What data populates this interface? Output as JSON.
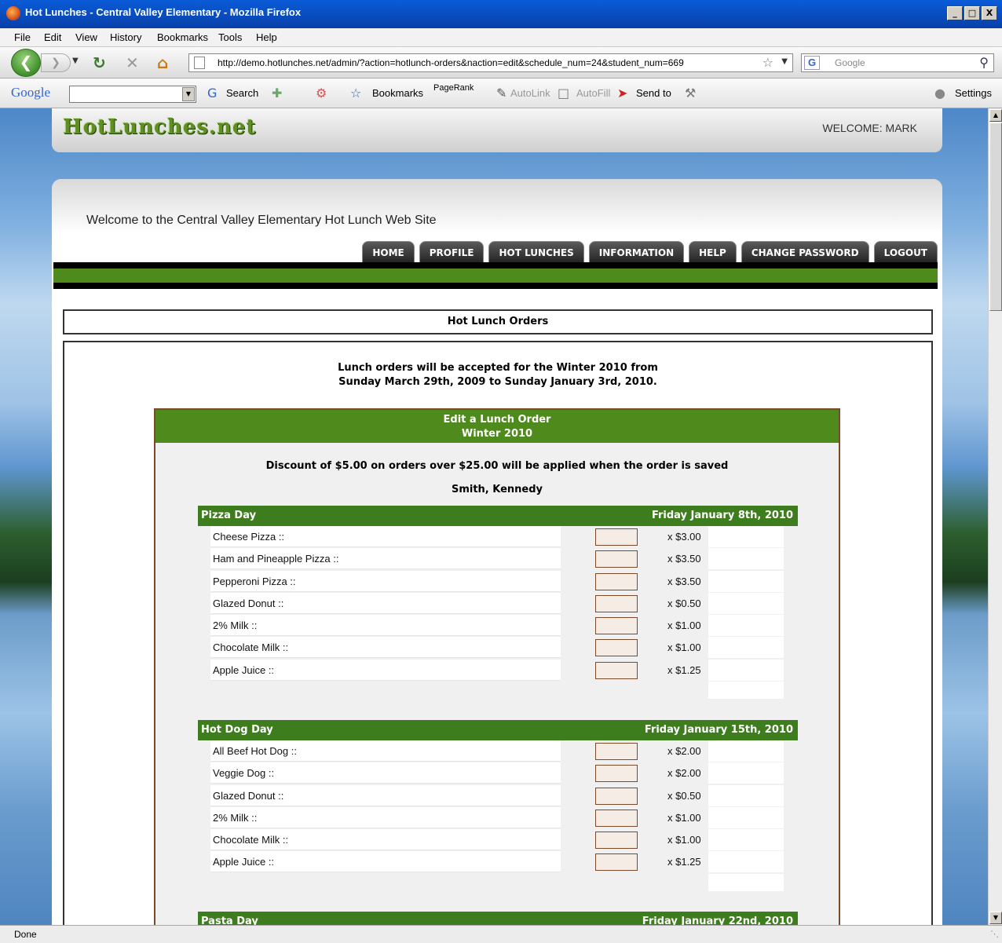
{
  "window": {
    "title": "Hot Lunches - Central Valley Elementary - Mozilla Firefox",
    "buttons": [
      "_",
      "□",
      "X"
    ]
  },
  "menu": [
    "File",
    "Edit",
    "View",
    "History",
    "Bookmarks",
    "Tools",
    "Help"
  ],
  "nav": {
    "url": "http://demo.hotlunches.net/admin/?action=hotlunch-orders&naction=edit&schedule_num=24&student_num=669",
    "search_placeholder": "Google"
  },
  "google_toolbar": {
    "logo": "Google",
    "search": "Search",
    "bookmarks": "Bookmarks",
    "pagerank": "PageRank",
    "autolink": "AutoLink",
    "autofill": "AutoFill",
    "sendto": "Send to",
    "settings": "Settings"
  },
  "status": "Done",
  "site": {
    "logo": "HotLunches.net",
    "welcome_user": "WELCOME: MARK",
    "welcome_text": "Welcome to the Central Valley Elementary Hot Lunch Web Site",
    "tabs": [
      "HOME",
      "PROFILE",
      "HOT LUNCHES",
      "INFORMATION",
      "HELP",
      "CHANGE PASSWORD",
      "LOGOUT"
    ],
    "page_title": "Hot Lunch Orders",
    "notice_line1": "Lunch orders will be accepted for the Winter 2010 from",
    "notice_line2": "Sunday March 29th, 2009 to Sunday January 3rd, 2010.",
    "panel_title": "Edit a Lunch Order",
    "panel_subtitle": "Winter 2010",
    "discount": "Discount of $5.00 on orders over $25.00 will be applied when the order is saved",
    "student": "Smith, Kennedy",
    "days": [
      {
        "name": "Pizza Day",
        "date": "Friday January 8th, 2010",
        "items": [
          {
            "name": "Cheese Pizza ::",
            "price": "x $3.00"
          },
          {
            "name": "Ham and Pineapple Pizza ::",
            "price": "x $3.50"
          },
          {
            "name": "Pepperoni Pizza ::",
            "price": "x $3.50"
          },
          {
            "name": "Glazed Donut ::",
            "price": "x $0.50"
          },
          {
            "name": "2% Milk ::",
            "price": "x $1.00"
          },
          {
            "name": "Chocolate Milk ::",
            "price": "x $1.00"
          },
          {
            "name": "Apple Juice ::",
            "price": "x $1.25"
          }
        ]
      },
      {
        "name": "Hot Dog Day",
        "date": "Friday January 15th, 2010",
        "items": [
          {
            "name": "All Beef Hot Dog ::",
            "price": "x $2.00"
          },
          {
            "name": "Veggie Dog ::",
            "price": "x $2.00"
          },
          {
            "name": "Glazed Donut ::",
            "price": "x $0.50"
          },
          {
            "name": "2% Milk ::",
            "price": "x $1.00"
          },
          {
            "name": "Chocolate Milk ::",
            "price": "x $1.00"
          },
          {
            "name": "Apple Juice ::",
            "price": "x $1.25"
          }
        ]
      },
      {
        "name": "Pasta Day",
        "date": "Friday January 22nd, 2010",
        "items": []
      }
    ]
  }
}
